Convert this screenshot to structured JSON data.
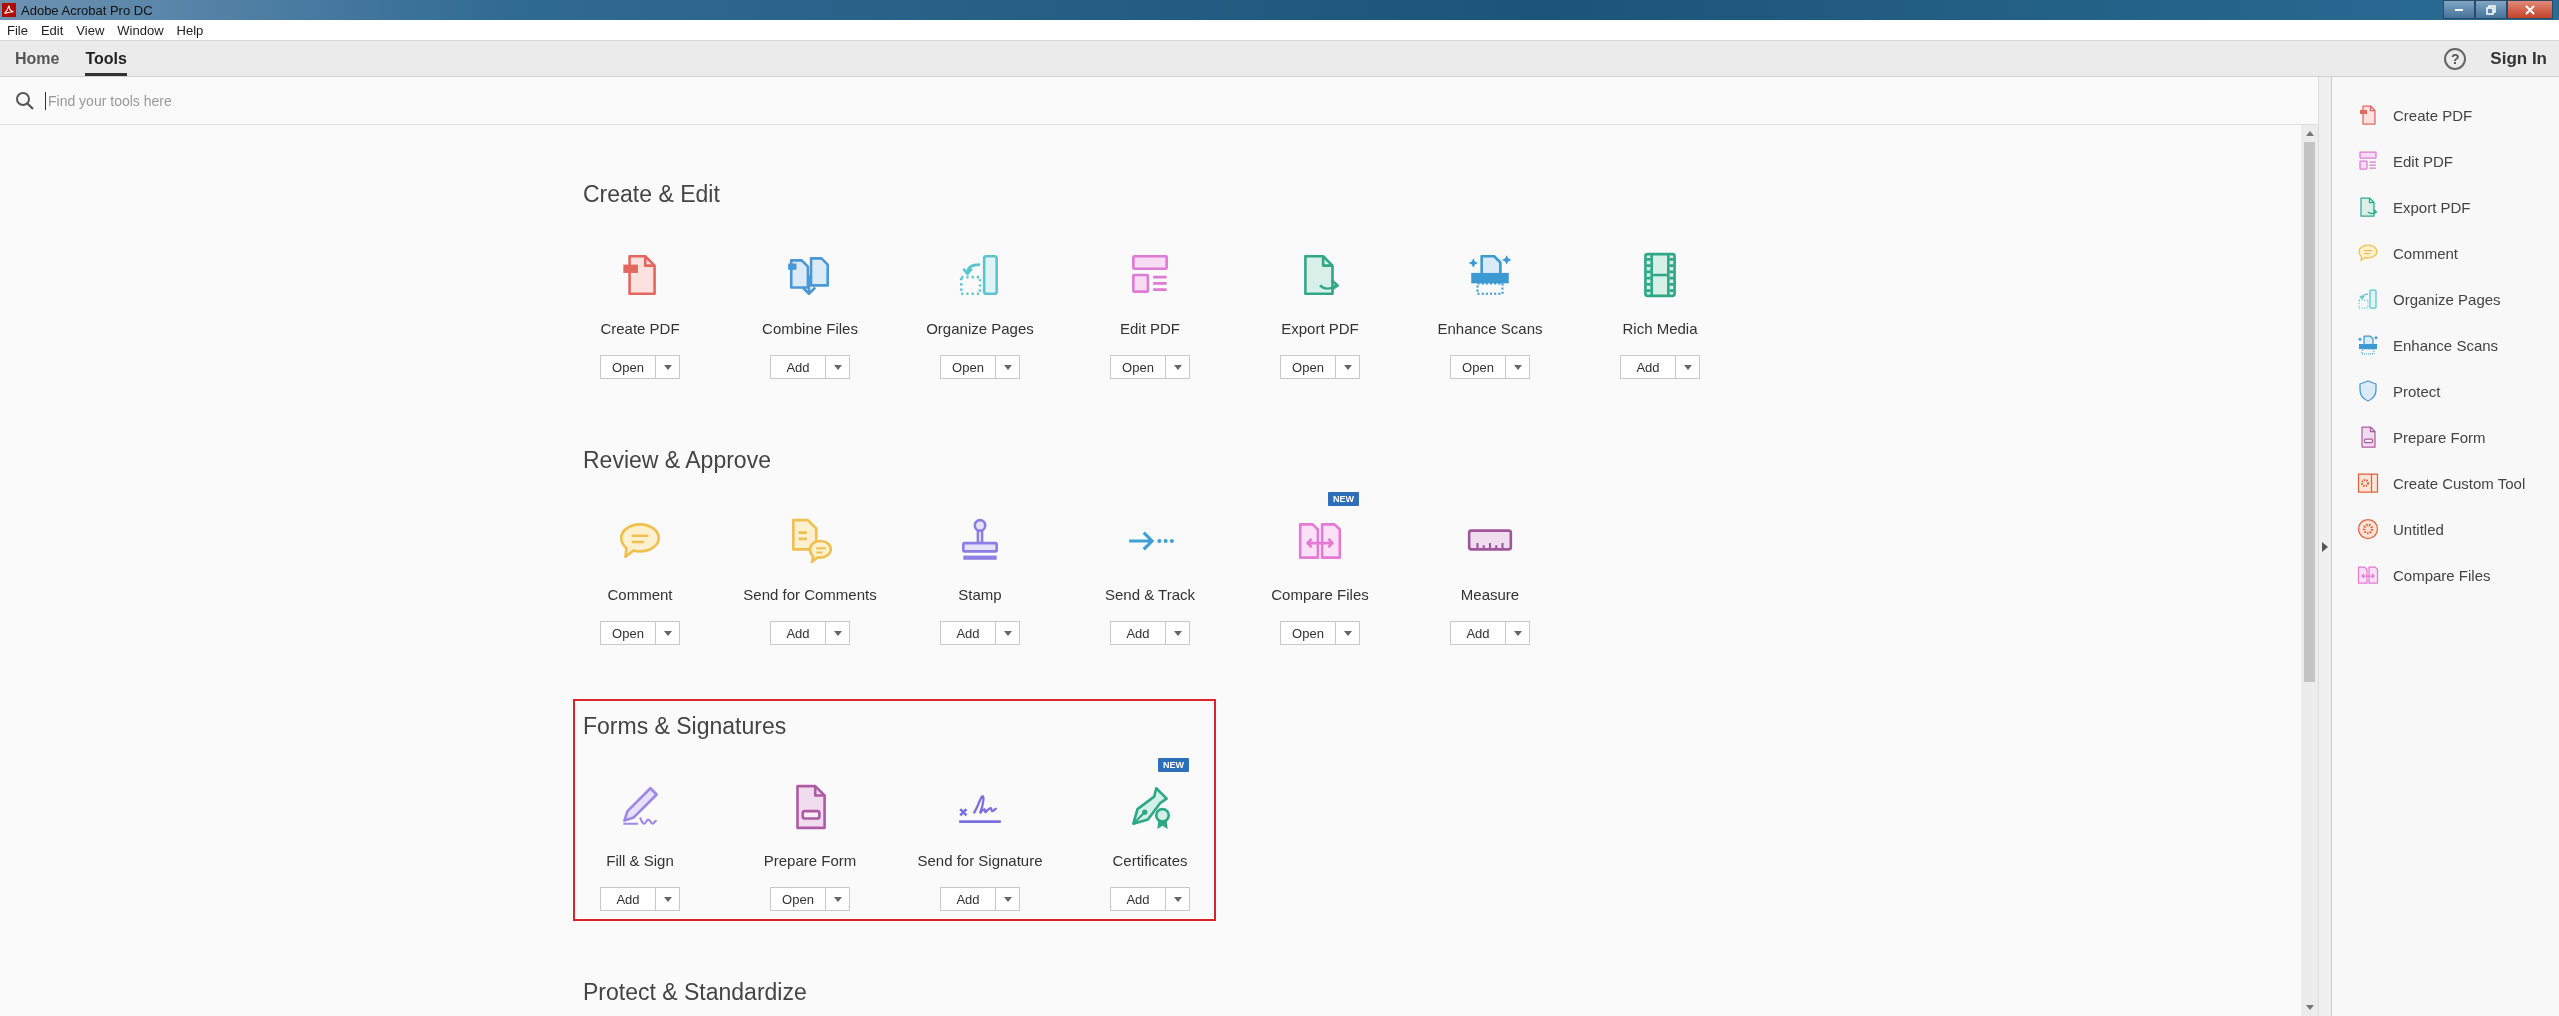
{
  "window": {
    "title": "Adobe Acrobat Pro DC"
  },
  "menu": [
    "File",
    "Edit",
    "View",
    "Window",
    "Help"
  ],
  "tabs": [
    {
      "label": "Home",
      "selected": false
    },
    {
      "label": "Tools",
      "selected": true
    }
  ],
  "account": {
    "help": "?",
    "sign_in": "Sign In"
  },
  "search": {
    "placeholder": "Find your tools here"
  },
  "sections": [
    {
      "title": "Create & Edit",
      "highlighted": false,
      "tools": [
        {
          "name": "Create PDF",
          "action": "Open"
        },
        {
          "name": "Combine Files",
          "action": "Add"
        },
        {
          "name": "Organize Pages",
          "action": "Open"
        },
        {
          "name": "Edit PDF",
          "action": "Open"
        },
        {
          "name": "Export PDF",
          "action": "Open"
        },
        {
          "name": "Enhance Scans",
          "action": "Open"
        },
        {
          "name": "Rich Media",
          "action": "Add"
        }
      ]
    },
    {
      "title": "Review & Approve",
      "highlighted": false,
      "tools": [
        {
          "name": "Comment",
          "action": "Open"
        },
        {
          "name": "Send for Comments",
          "action": "Add"
        },
        {
          "name": "Stamp",
          "action": "Add"
        },
        {
          "name": "Send & Track",
          "action": "Add"
        },
        {
          "name": "Compare Files",
          "action": "Open",
          "badge": "NEW"
        },
        {
          "name": "Measure",
          "action": "Add"
        }
      ]
    },
    {
      "title": "Forms & Signatures",
      "highlighted": true,
      "tools": [
        {
          "name": "Fill & Sign",
          "action": "Add"
        },
        {
          "name": "Prepare Form",
          "action": "Open"
        },
        {
          "name": "Send for Signature",
          "action": "Add"
        },
        {
          "name": "Certificates",
          "action": "Add",
          "badge": "NEW"
        }
      ]
    },
    {
      "title": "Protect & Standardize",
      "highlighted": false
    }
  ],
  "sidebar": {
    "items": [
      "Create PDF",
      "Edit PDF",
      "Export PDF",
      "Comment",
      "Organize Pages",
      "Enhance Scans",
      "Protect",
      "Prepare Form",
      "Create Custom Tool",
      "Untitled",
      "Compare Files"
    ]
  }
}
